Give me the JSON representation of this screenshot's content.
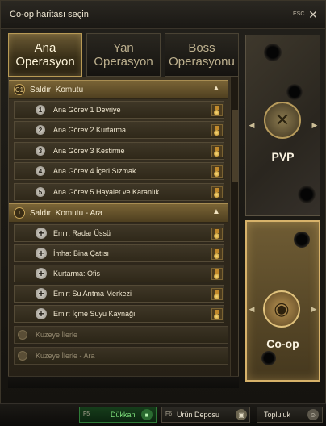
{
  "window": {
    "title": "Co-op haritası seçin",
    "esc_label": "ESC",
    "close_glyph": "✕"
  },
  "tabs": [
    {
      "line1": "Ana",
      "line2": "Operasyon",
      "active": true
    },
    {
      "line1": "Yan",
      "line2": "Operasyon",
      "active": false
    },
    {
      "line1": "Boss",
      "line2": "Operasyonu",
      "active": false
    }
  ],
  "sections": [
    {
      "icon": "C1",
      "title": "Saldırı Komutu",
      "expanded": true,
      "items": [
        {
          "marker": "1",
          "label": "Ana Görev 1 Devriye"
        },
        {
          "marker": "2",
          "label": "Ana Görev 2 Kurtarma"
        },
        {
          "marker": "3",
          "label": "Ana Görev 3 Kestirme"
        },
        {
          "marker": "4",
          "label": "Ana Görev 4 İçeri Sızmak"
        },
        {
          "marker": "5",
          "label": "Ana Görev 5 Hayalet ve Karanlık"
        }
      ]
    },
    {
      "icon": "!",
      "title": "Saldırı Komutu - Ara",
      "expanded": true,
      "items": [
        {
          "marker": "+",
          "label": "Emir: Radar Üssü"
        },
        {
          "marker": "+",
          "label": "İmha: Bina Çatısı"
        },
        {
          "marker": "+",
          "label": "Kurtarma: Ofis"
        },
        {
          "marker": "+",
          "label": "Emir: Su Arıtma Merkezi"
        },
        {
          "marker": "+",
          "label": "Emir: İçme Suyu Kaynağı"
        }
      ]
    }
  ],
  "locked_sections": [
    {
      "title": "Kuzeye İlerle"
    },
    {
      "title": "Kuzeye İlerle - Ara"
    }
  ],
  "modes": {
    "pvp": {
      "label": "PVP",
      "selected": false
    },
    "coop": {
      "label": "Co-op",
      "selected": true
    }
  },
  "bottombar": {
    "shop": {
      "key": "F5",
      "label": "Dükkan"
    },
    "depot": {
      "key": "F6",
      "label": "Ürün Deposu"
    },
    "community": {
      "label": "Topluluk"
    }
  },
  "colors": {
    "accent_gold": "#d7b26a",
    "shop_green": "#7ee07c"
  }
}
